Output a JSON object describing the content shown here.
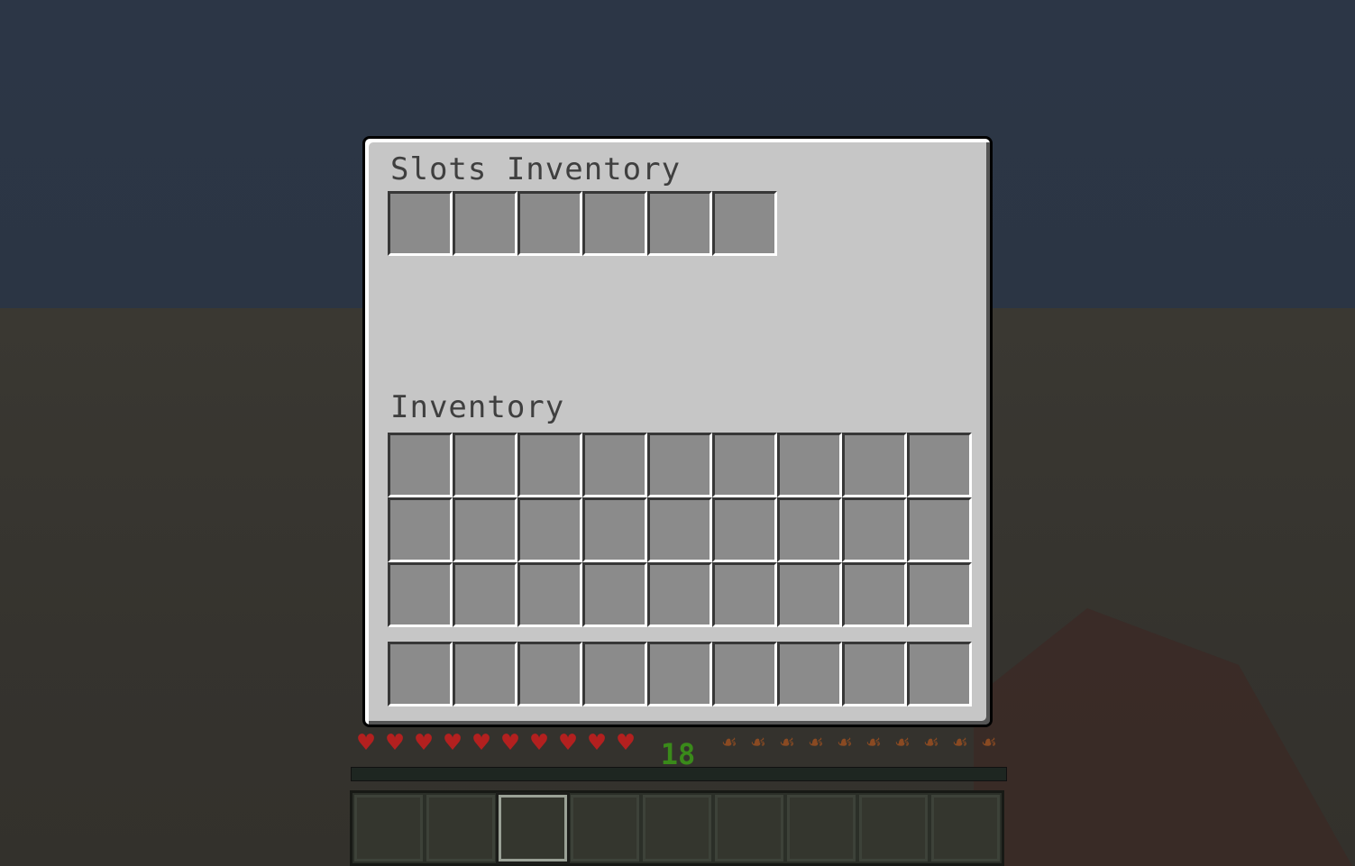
{
  "screen": {
    "slots_title": "Slots Inventory",
    "inventory_title": "Inventory",
    "custom_slot_count": 6,
    "main_slot_count": 27,
    "hotbar_slot_count": 9
  },
  "hud": {
    "health_icon": "heart-icon",
    "health_count": 10,
    "hunger_icon": "drumstick-icon",
    "hunger_count": 10,
    "experience_level": "18",
    "experience_progress": 0.0,
    "hotbar_slots": 9,
    "hotbar_selected": 3
  },
  "colors": {
    "panel": "#c6c6c6",
    "slot": "#8b8b8b",
    "title_text": "#3f3f3f",
    "heart": "#b3201f",
    "level_text": "#3a8a1a",
    "sky": "#2c3646"
  }
}
